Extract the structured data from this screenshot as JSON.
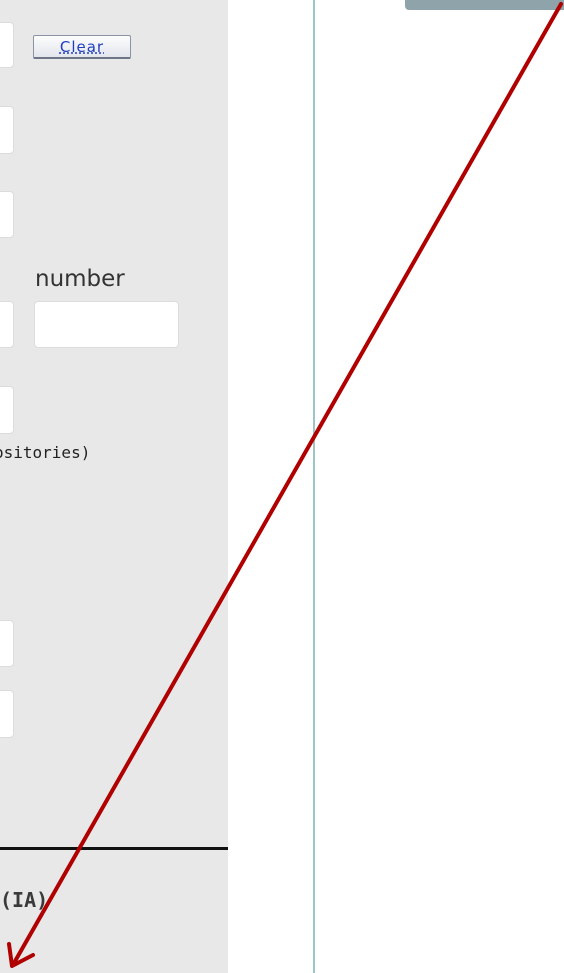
{
  "form": {
    "clear_button_label": "Clear",
    "number_label": "number",
    "repositories_text": "ositories)",
    "ia_heading": "(IA)"
  },
  "colors": {
    "panel_background": "#e8e8e8",
    "divider": "#9fc3c6",
    "tab": "#8ea4aa",
    "annotation_arrow": "#b00000"
  },
  "icons": {
    "annotation": "red-arrow-pointer"
  }
}
